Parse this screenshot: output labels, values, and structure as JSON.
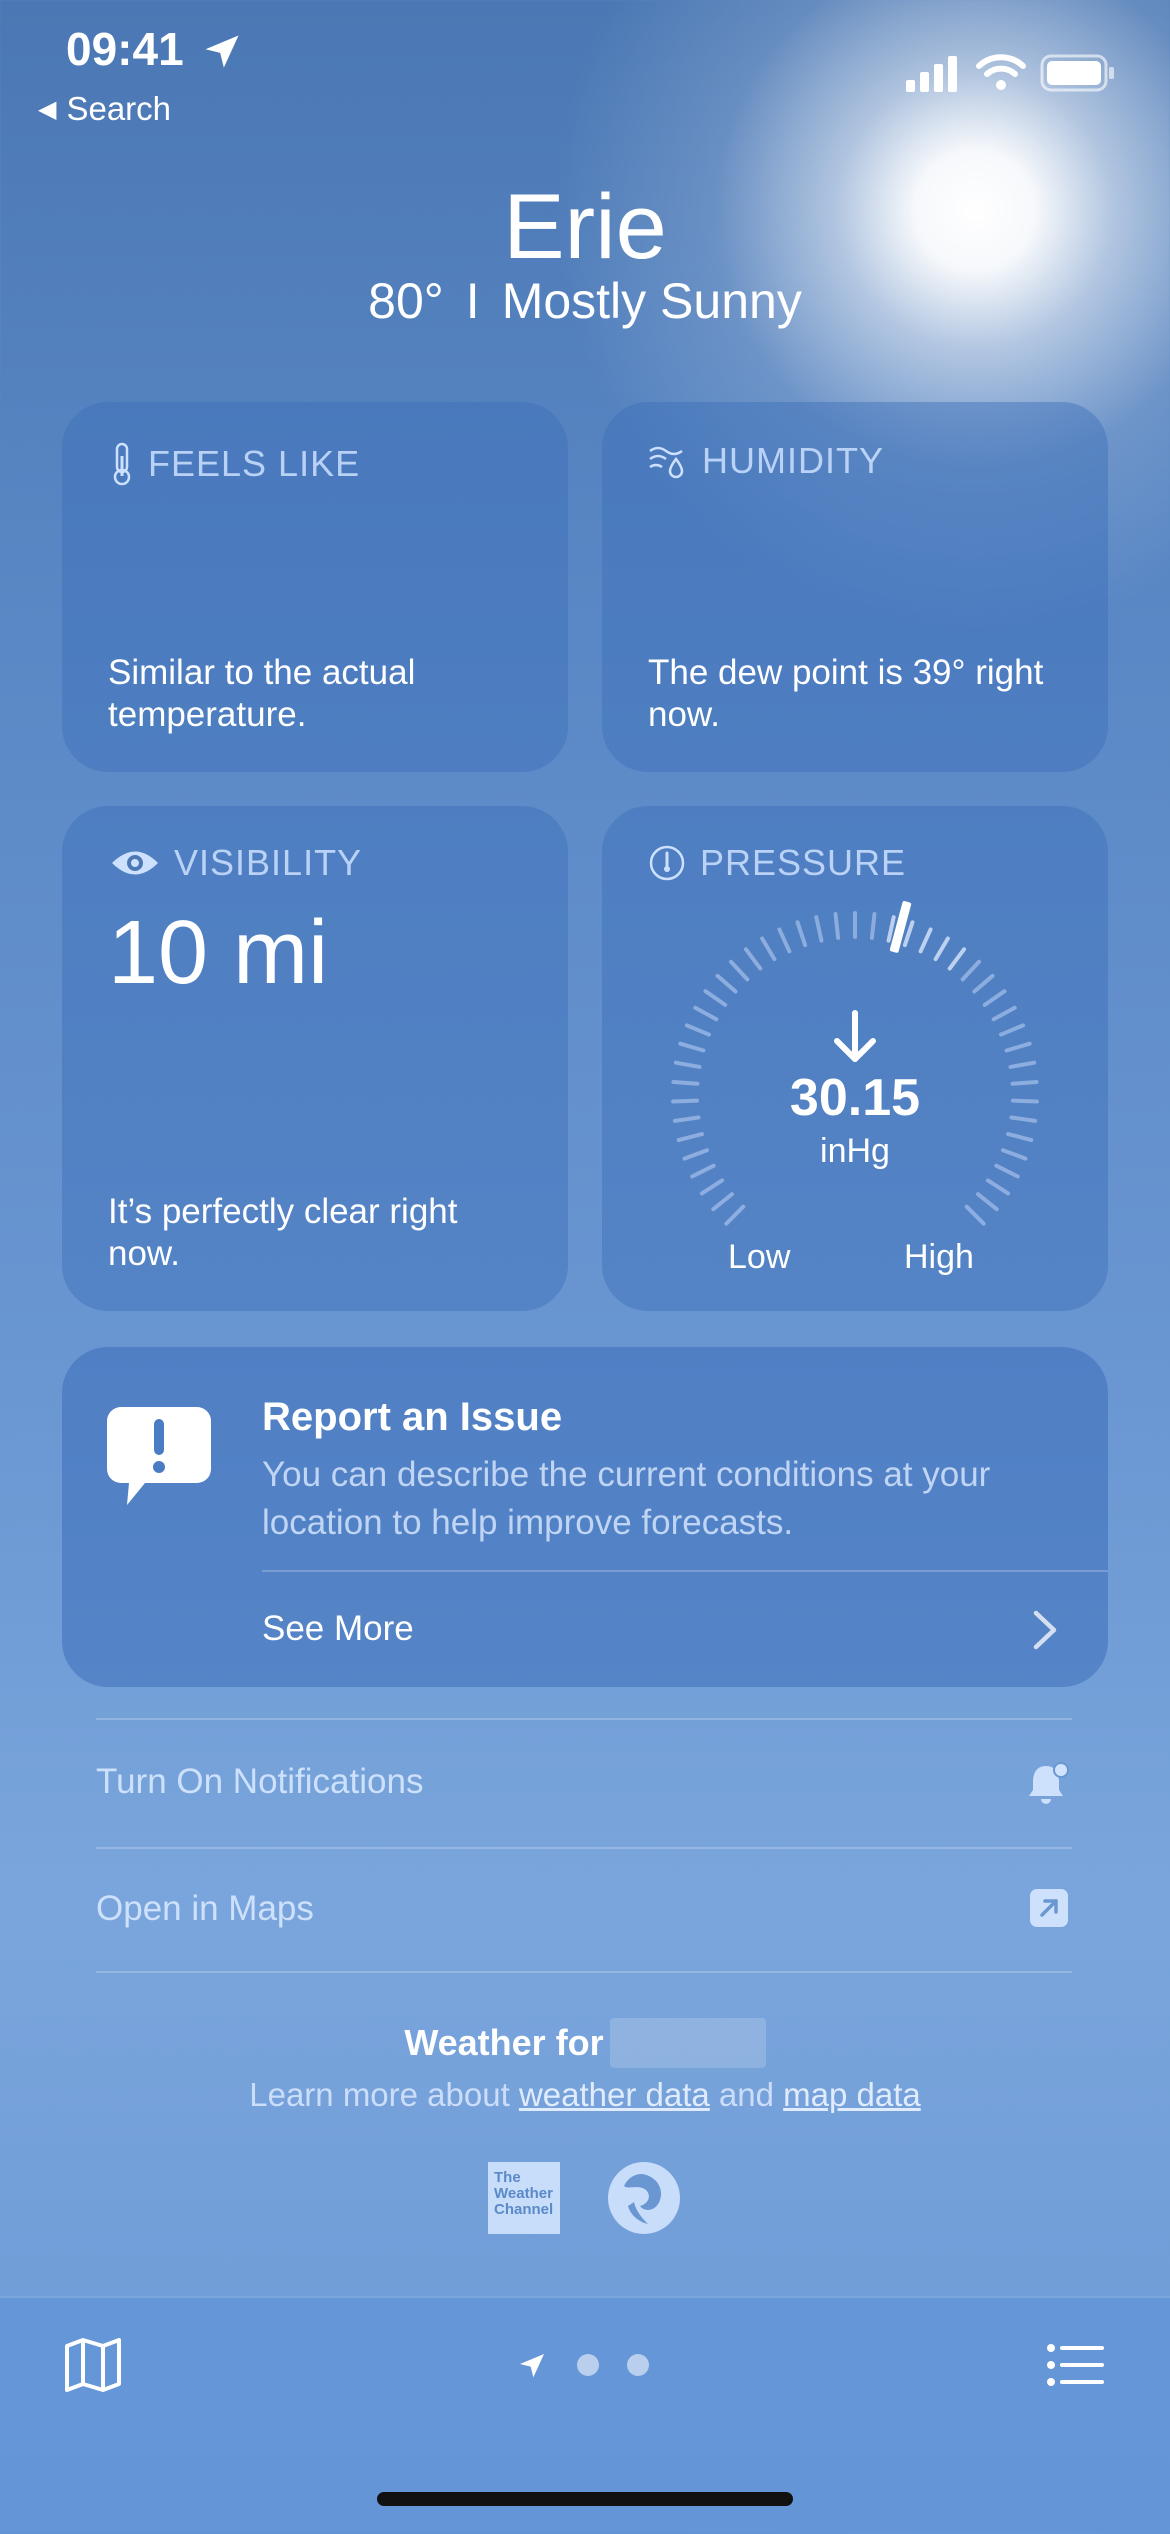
{
  "status_bar": {
    "time": "09:41",
    "back_label": "Search"
  },
  "header": {
    "city": "Erie",
    "temperature": "80°",
    "separator": "I",
    "condition": "Mostly Sunny"
  },
  "feels_like": {
    "title": "FEELS LIKE",
    "text": "Similar to the actual temperature."
  },
  "humidity": {
    "title": "HUMIDITY",
    "text": "The dew point is 39° right now."
  },
  "visibility": {
    "title": "VISIBILITY",
    "value": "10 mi",
    "text": "It’s perfectly clear right now."
  },
  "pressure": {
    "title": "PRESSURE",
    "value": "30.15",
    "unit": "inHg",
    "low_label": "Low",
    "high_label": "High",
    "trend": "falling"
  },
  "report": {
    "title": "Report an Issue",
    "description": "You can describe the current conditions at your location to help improve forecasts.",
    "see_more": "See More"
  },
  "actions": {
    "notifications": "Turn On Notifications",
    "maps": "Open in Maps"
  },
  "footer": {
    "weather_for": "Weather for",
    "learn_prefix": "Learn more about",
    "weather_data_link": "weather data",
    "and_text": "and",
    "map_data_link": "map data",
    "twc_logo_text": "The Weather Channel"
  },
  "tab_bar": {
    "page_count": 3,
    "active_page": 0
  },
  "colors": {
    "card_bg": "#3c6eb9",
    "label": "#cde1ff",
    "bottom_bar": "#6596d6"
  }
}
